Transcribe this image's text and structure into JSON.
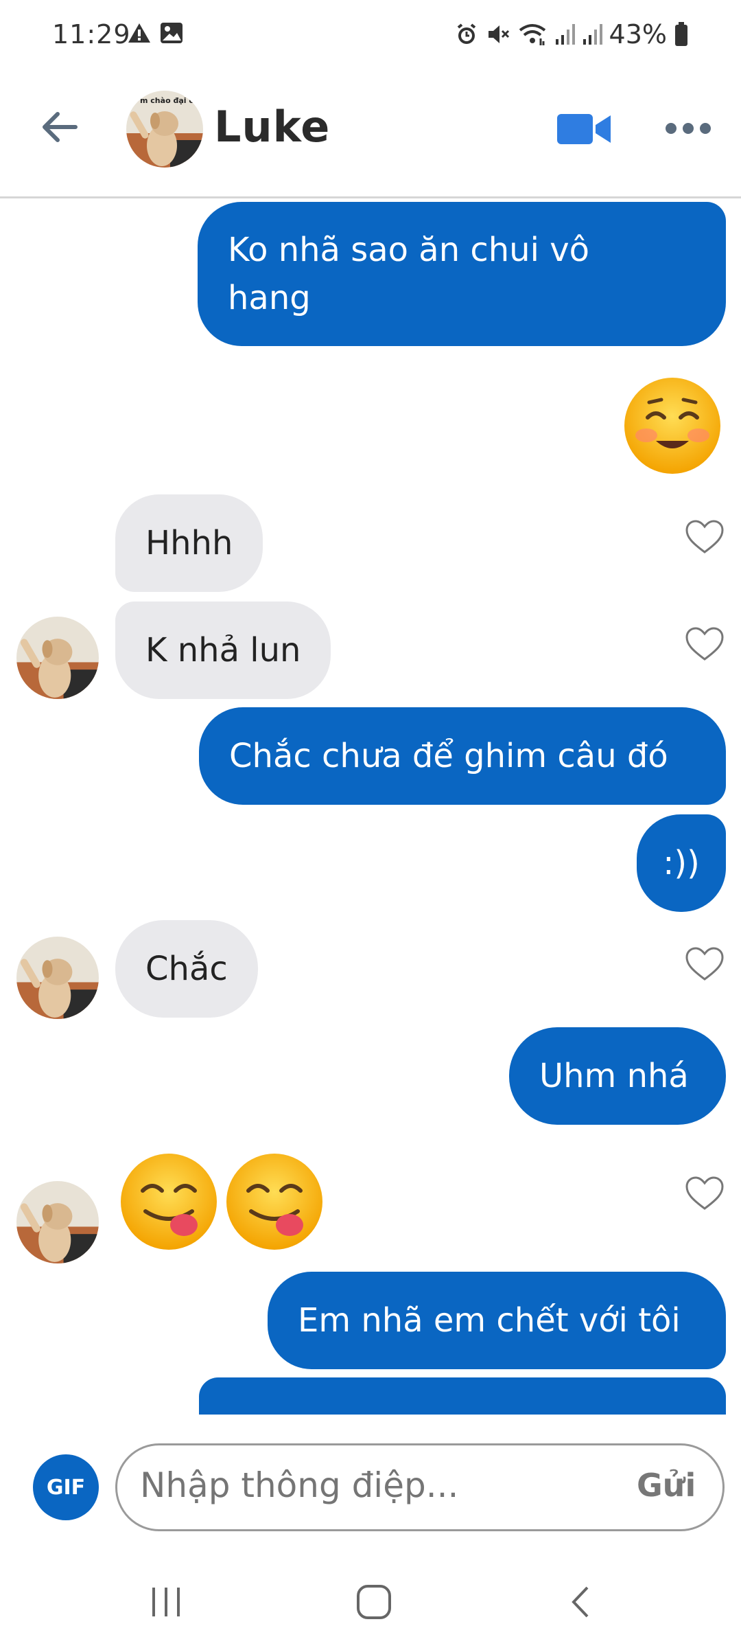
{
  "status_bar": {
    "time": "11:29",
    "battery": "43%"
  },
  "header": {
    "contact_name": "Luke",
    "avatar_caption": "m chào đại c"
  },
  "messages": [
    {
      "side": "out",
      "text_line1": "Ko nhã sao ăn chui vô",
      "text_line2": "hang"
    },
    {
      "side": "out",
      "type": "emoji",
      "emoji": "smiling-blush-face"
    },
    {
      "side": "in",
      "text": "Hhhh"
    },
    {
      "side": "in",
      "text": "K nhả lun"
    },
    {
      "side": "out",
      "text": "Chắc chưa để ghim câu đó"
    },
    {
      "side": "out",
      "text": ":))"
    },
    {
      "side": "in",
      "text": "Chắc"
    },
    {
      "side": "out",
      "text": "Uhm nhá"
    },
    {
      "side": "in",
      "type": "emoji",
      "emoji": "face-savoring-food",
      "count": 2
    },
    {
      "side": "out",
      "text": "Em nhã em chết với tôi"
    }
  ],
  "composer": {
    "gif_label": "GIF",
    "placeholder": "Nhập thông điệp...",
    "send_label": "Gửi"
  },
  "colors": {
    "accent": "#0a66c2",
    "incoming_bubble": "#e9e9ec"
  }
}
